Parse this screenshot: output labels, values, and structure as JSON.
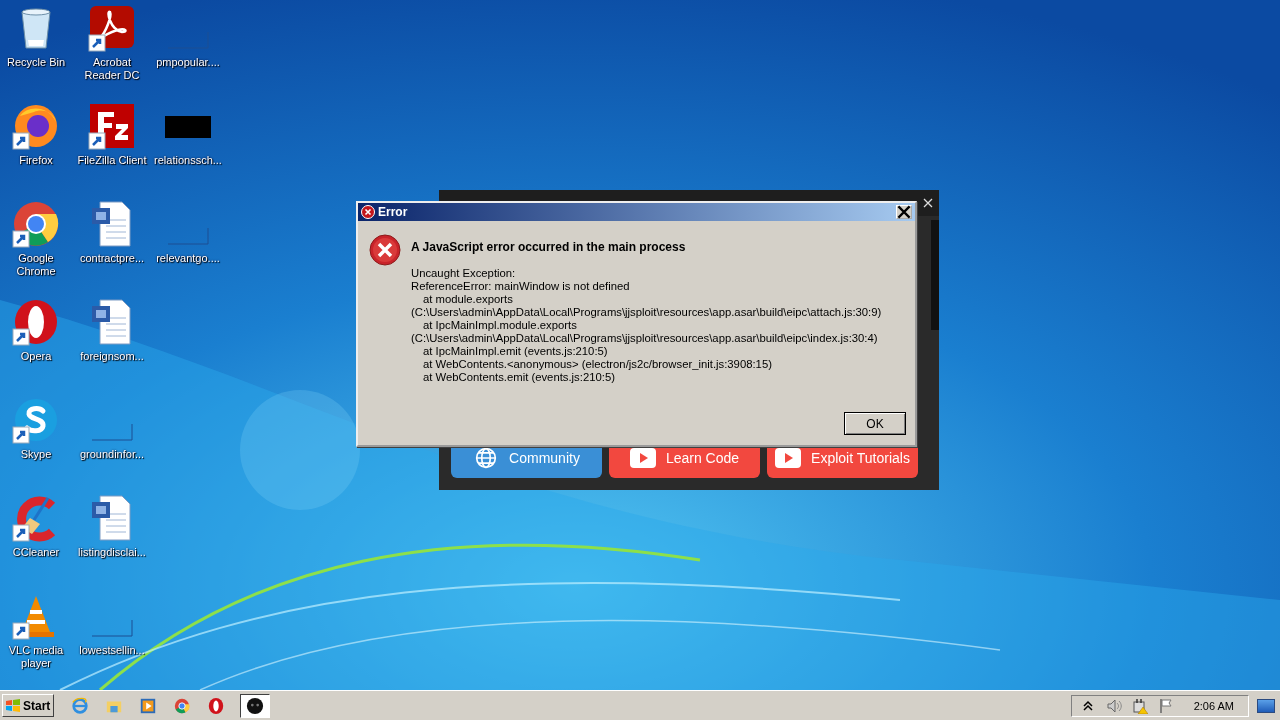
{
  "desktop": {
    "icons": [
      {
        "label": "Recycle Bin",
        "kind": "recycle",
        "shortcut": false
      },
      {
        "label": "Firefox",
        "kind": "firefox",
        "shortcut": true
      },
      {
        "label": "Google Chrome",
        "kind": "chrome",
        "shortcut": true
      },
      {
        "label": "Opera",
        "kind": "opera",
        "shortcut": true
      },
      {
        "label": "Skype",
        "kind": "skype",
        "shortcut": true
      },
      {
        "label": "CCleaner",
        "kind": "ccleaner",
        "shortcut": true
      },
      {
        "label": "VLC media player",
        "kind": "vlc",
        "shortcut": true
      },
      {
        "label": "Acrobat Reader DC",
        "kind": "acrobat",
        "shortcut": true
      },
      {
        "label": "FileZilla Client",
        "kind": "filezilla",
        "shortcut": true
      },
      {
        "label": "contractpre...",
        "kind": "word",
        "shortcut": false
      },
      {
        "label": "foreignsom...",
        "kind": "word",
        "shortcut": false
      },
      {
        "label": "groundinfor...",
        "kind": "blank",
        "shortcut": false
      },
      {
        "label": "listingdisclai...",
        "kind": "word",
        "shortcut": false
      },
      {
        "label": "lowestsellin...",
        "kind": "blank",
        "shortcut": false
      },
      {
        "label": "pmpopular....",
        "kind": "blank",
        "shortcut": false
      },
      {
        "label": "relationssch...",
        "kind": "black",
        "shortcut": false
      },
      {
        "label": "relevantgo....",
        "kind": "blank",
        "shortcut": false
      }
    ]
  },
  "app_window": {
    "buttons": [
      {
        "label": "Community",
        "kind": "globe",
        "color": "#3a8fd6"
      },
      {
        "label": "Learn Code",
        "kind": "video",
        "color": "#f2483f"
      },
      {
        "label": "Exploit Tutorials",
        "kind": "video",
        "color": "#f2483f"
      }
    ]
  },
  "dialog": {
    "title": "Error",
    "heading": "A JavaScript error occurred in the main process",
    "lines": [
      {
        "text": "Uncaught Exception:",
        "kind": "message"
      },
      {
        "text": "ReferenceError: mainWindow is not defined",
        "kind": "message"
      },
      {
        "text": "at module.exports",
        "kind": "frame"
      },
      {
        "text": "(C:\\Users\\admin\\AppData\\Local\\Programs\\jjsploit\\resources\\app.asar\\build\\eipc\\attach.js:30:9)",
        "kind": "message"
      },
      {
        "text": "at IpcMainImpl.module.exports",
        "kind": "frame"
      },
      {
        "text": "(C:\\Users\\admin\\AppData\\Local\\Programs\\jjsploit\\resources\\app.asar\\build\\eipc\\index.js:30:4)",
        "kind": "message"
      },
      {
        "text": "at IpcMainImpl.emit (events.js:210:5)",
        "kind": "frame"
      },
      {
        "text": "at WebContents.<anonymous> (electron/js2c/browser_init.js:3908:15)",
        "kind": "frame"
      },
      {
        "text": "at WebContents.emit (events.js:210:5)",
        "kind": "frame"
      }
    ],
    "button": "OK"
  },
  "taskbar": {
    "start": "Start",
    "items": [
      {
        "kind": "ie",
        "active": false
      },
      {
        "kind": "explorer",
        "active": false
      },
      {
        "kind": "media",
        "active": false
      },
      {
        "kind": "chrome",
        "active": false
      },
      {
        "kind": "opera",
        "active": false
      },
      {
        "kind": "app",
        "active": true
      }
    ],
    "clock": "2:06 AM"
  }
}
